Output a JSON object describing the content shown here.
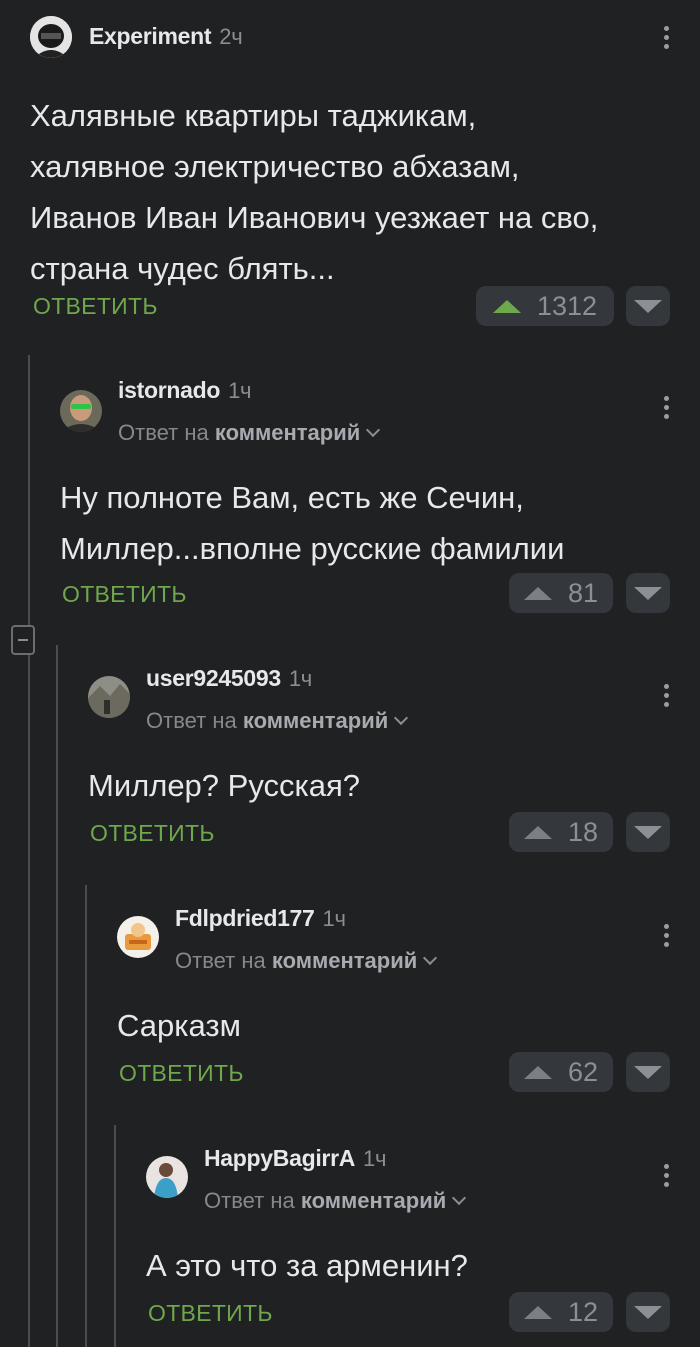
{
  "colors": {
    "background": "#1f2123",
    "reply": "#6fa74d",
    "upvote_active": "#6fa74d",
    "muted": "#8a8e93"
  },
  "comments": [
    {
      "username": "Experiment",
      "time": "2ч",
      "text": [
        "Халявные квартиры таджикам,",
        "халявное электричество абхазам,",
        "Иванов Иван Иванович уезжает на сво,",
        "страна чудес блять..."
      ],
      "reply_label": "ОТВЕТИТЬ",
      "votes": "1312",
      "avatar": "helmet-avatar"
    },
    {
      "username": "istornado",
      "time": "1ч",
      "reply_prefix": "Ответ на",
      "reply_target": "комментарий",
      "text": [
        "Ну полноте Вам, есть же Сечин,",
        "Миллер...вполне русские фамилии"
      ],
      "reply_label": "ОТВЕТИТЬ",
      "votes": "81",
      "avatar": "man-sunglasses-avatar"
    },
    {
      "username": "user9245093",
      "time": "1ч",
      "reply_prefix": "Ответ на",
      "reply_target": "комментарий",
      "text": [
        "Миллер? Русская?"
      ],
      "reply_label": "ОТВЕТИТЬ",
      "votes": "18",
      "avatar": "landscape-avatar"
    },
    {
      "username": "Fdlpdried177",
      "time": "1ч",
      "reply_prefix": "Ответ на",
      "reply_target": "комментарий",
      "text": [
        "Сарказм"
      ],
      "reply_label": "ОТВЕТИТЬ",
      "votes": "62",
      "avatar": "cartoon-avatar"
    },
    {
      "username": "HappyBagirrA",
      "time": "1ч",
      "reply_prefix": "Ответ на",
      "reply_target": "комментарий",
      "text": [
        "А это что за арменин?"
      ],
      "reply_label": "ОТВЕТИТЬ",
      "votes": "12",
      "avatar": "woman-avatar"
    }
  ]
}
